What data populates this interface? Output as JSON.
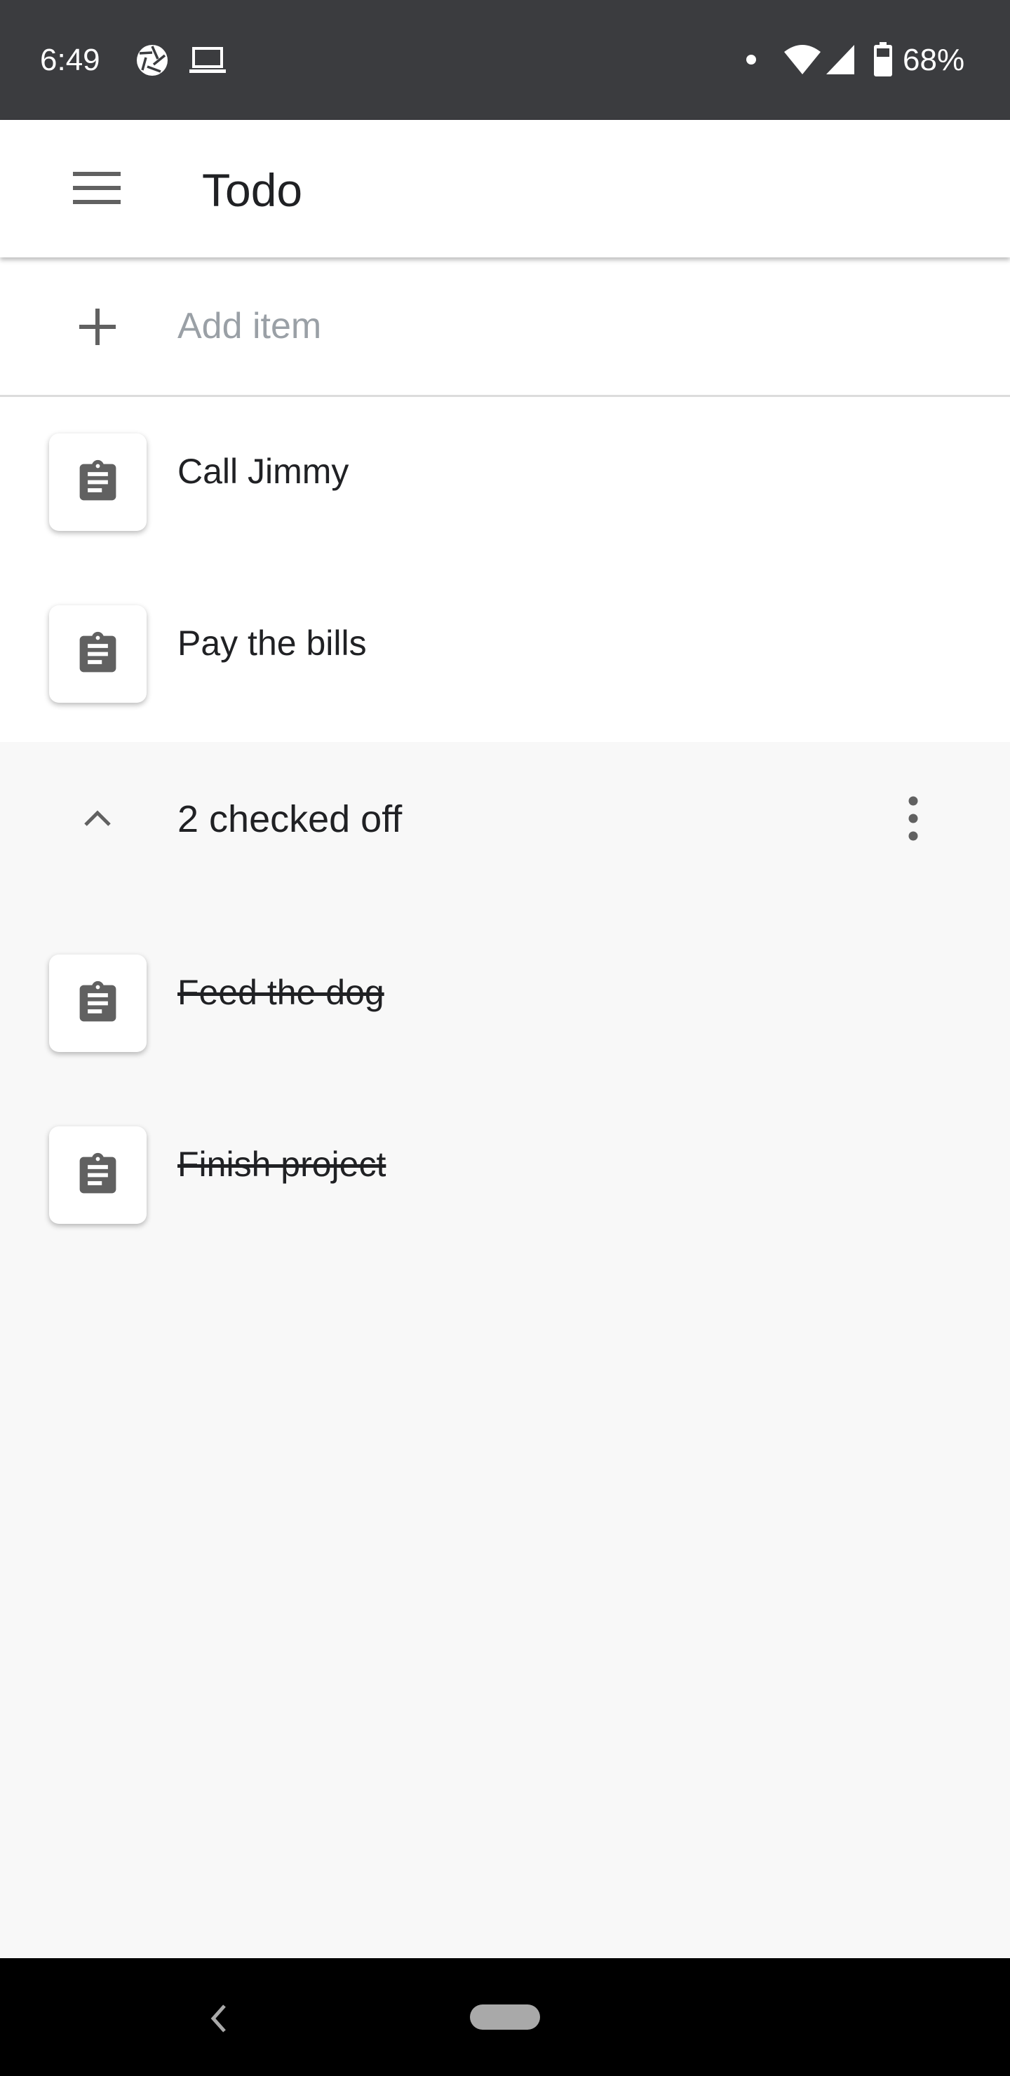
{
  "status_bar": {
    "time": "6:49",
    "battery": "68%",
    "icons": [
      "camera-aperture-icon",
      "laptop-icon",
      "notification-dot-icon",
      "wifi-icon",
      "cell-signal-icon",
      "battery-icon"
    ]
  },
  "app_bar": {
    "title": "Todo",
    "menu_icon": "hamburger-menu-icon"
  },
  "add_item": {
    "placeholder": "Add item",
    "icon": "plus-icon"
  },
  "active_items": [
    {
      "label": "Call Jimmy",
      "icon": "clipboard-icon"
    },
    {
      "label": "Pay the bills",
      "icon": "clipboard-icon"
    }
  ],
  "checked_section": {
    "title": "2 checked off",
    "collapse_icon": "chevron-up-icon",
    "menu_icon": "more-vert-icon",
    "items": [
      {
        "label": "Feed the dog",
        "icon": "clipboard-icon"
      },
      {
        "label": "Finish project",
        "icon": "clipboard-icon"
      }
    ]
  },
  "colors": {
    "status_bar_bg": "#3b3c3f",
    "surface": "#ffffff",
    "checked_bg": "#f8f8f8",
    "icon_gray": "#616161",
    "text": "#202124",
    "placeholder": "#9aa0a6"
  }
}
